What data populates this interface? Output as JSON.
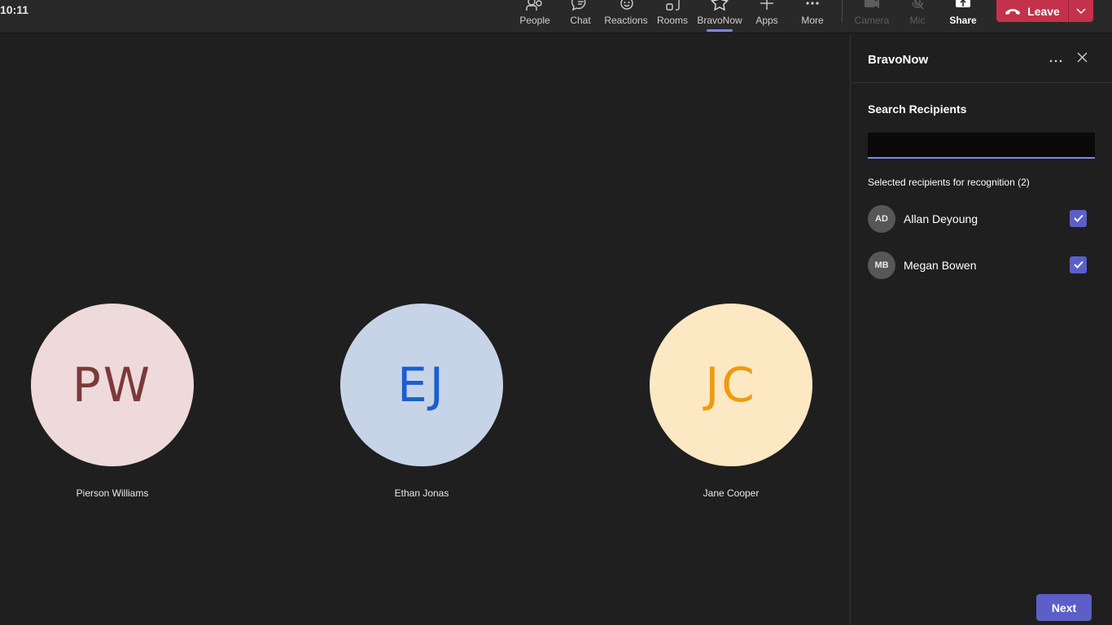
{
  "clock": "10:11",
  "toolbar": {
    "items": [
      {
        "label": "People",
        "icon": "people-icon"
      },
      {
        "label": "Chat",
        "icon": "chat-icon"
      },
      {
        "label": "Reactions",
        "icon": "reactions-icon"
      },
      {
        "label": "Rooms",
        "icon": "rooms-icon"
      },
      {
        "label": "BravoNow",
        "icon": "star-icon",
        "active": true
      },
      {
        "label": "Apps",
        "icon": "plus-icon"
      },
      {
        "label": "More",
        "icon": "more-icon"
      },
      {
        "label": "Camera",
        "icon": "camera-off-icon",
        "disabled": true
      },
      {
        "label": "Mic",
        "icon": "mic-off-icon",
        "disabled": true
      },
      {
        "label": "Share",
        "icon": "share-icon"
      }
    ],
    "leave_label": "Leave"
  },
  "participants": [
    {
      "initials": "PW",
      "name": "Pierson Williams",
      "bg": "#eed9db",
      "fg": "#7a3a3a"
    },
    {
      "initials": "EJ",
      "name": "Ethan Jonas",
      "bg": "#c7d4e8",
      "fg": "#1a5fd1"
    },
    {
      "initials": "JC",
      "name": "Jane Cooper",
      "bg": "#fde8c4",
      "fg": "#f09a10"
    }
  ],
  "panel": {
    "title": "BravoNow",
    "search_label": "Search Recipients",
    "search_value": "",
    "selected_label": "Selected recipients for recognition (2)",
    "recipients": [
      {
        "initials": "AD",
        "name": "Allan Deyoung",
        "checked": true
      },
      {
        "initials": "MB",
        "name": "Megan Bowen",
        "checked": true
      }
    ],
    "next_label": "Next"
  },
  "colors": {
    "accent": "#5b5fc7",
    "leave": "#c4314b",
    "background": "#1f1f1f"
  }
}
